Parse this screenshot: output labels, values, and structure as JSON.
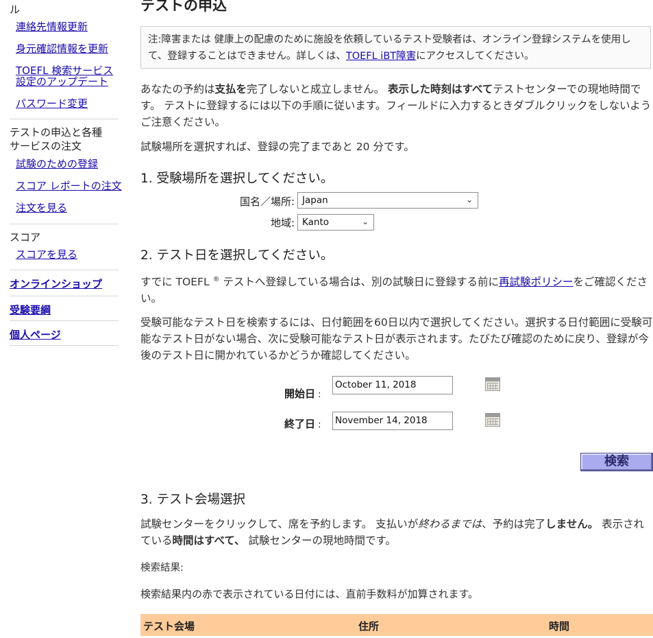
{
  "sidebar": {
    "top_partial": "ル",
    "links1": [
      "連絡先情報更新",
      "身元確認情報を更新",
      "TOEFL 検索サービス",
      "設定のアップデート",
      "パスワード変更"
    ],
    "section_register_line1": "テストの申込と各種",
    "section_register_line2": "サービスの注文",
    "links2": [
      "試験のための登録",
      "スコア レポートの注文",
      "注文を見る"
    ],
    "section_score": "スコア",
    "score_link": "スコアを見る",
    "bold_links": [
      "オンラインショップ",
      "受験要綱",
      "個人ページ"
    ]
  },
  "main": {
    "title": "テストの申込",
    "notice_text_a": "注:障害または 健康上の配慮のために施設を依頼しているテスト受験者は、オンライン登録システムを使用して、登録することはできません。詳しくは、",
    "notice_link": "TOEFL iBT障害",
    "notice_text_b": "にアクセスしてください。",
    "intro_a": "あなたの予約は",
    "intro_b": "支払を",
    "intro_c": "完了しないと成立しません。 ",
    "intro_d": "表示した時刻はすべて",
    "intro_e": "テストセンターでの現地時間です。 テストに登録するには以下の手順に従います。フィールドに入力するときダブルクリックをしないようご注意ください。",
    "time_note": "試験場所を選択すれば、登録の完了まであと 20 分です。",
    "step1": "1. 受験場所を選択してください。",
    "country_label": "国名／場所:",
    "country_value": "Japan",
    "region_label": "地域:",
    "region_value": "Kanto",
    "step2": "2. テスト日を選択してください。",
    "retest_a": "すでに TOEFL ",
    "retest_reg": "®",
    "retest_b": " テストへ登録している場合は、別の試験日に登録する前に",
    "retest_link": "再試験ポリシー",
    "retest_c": "をご確認ください。",
    "date_range_note": "受験可能なテスト日を検索するには、日付範囲を60日以内で選択してください。選択する日付範囲に受験可能なテスト日がない場合、次に受験可能なテスト日が表示されます。たびたび確認のために戻り、登録が今後のテスト日に開かれているかどうか確認してください。",
    "start_label": "開始日",
    "start_value": "October 11, 2018",
    "end_label": "終了日",
    "end_value": "November 14, 2018",
    "colon": ":",
    "search_label": "検索",
    "step3": "3. テスト会場選択",
    "center_a": "試験センターをクリックして、席を予約します。 支払いが",
    "center_b": "終わるまでは",
    "center_c": "、予約は完了",
    "center_d": "しません。",
    "center_e": " 表示されている",
    "center_f": "時間はすべて、",
    "center_g": " 試験センターの現地時間です。",
    "results_label": "検索結果:",
    "red_note": "検索結果内の赤で表示されている日付には、直前手数料が加算されます。",
    "table_headers": [
      "テスト会場",
      "住所",
      "時間"
    ]
  },
  "colors": {
    "link": "#1a0dab",
    "table_header_bg": "#ffcc99",
    "search_btn_bg": "#aaaaee"
  }
}
